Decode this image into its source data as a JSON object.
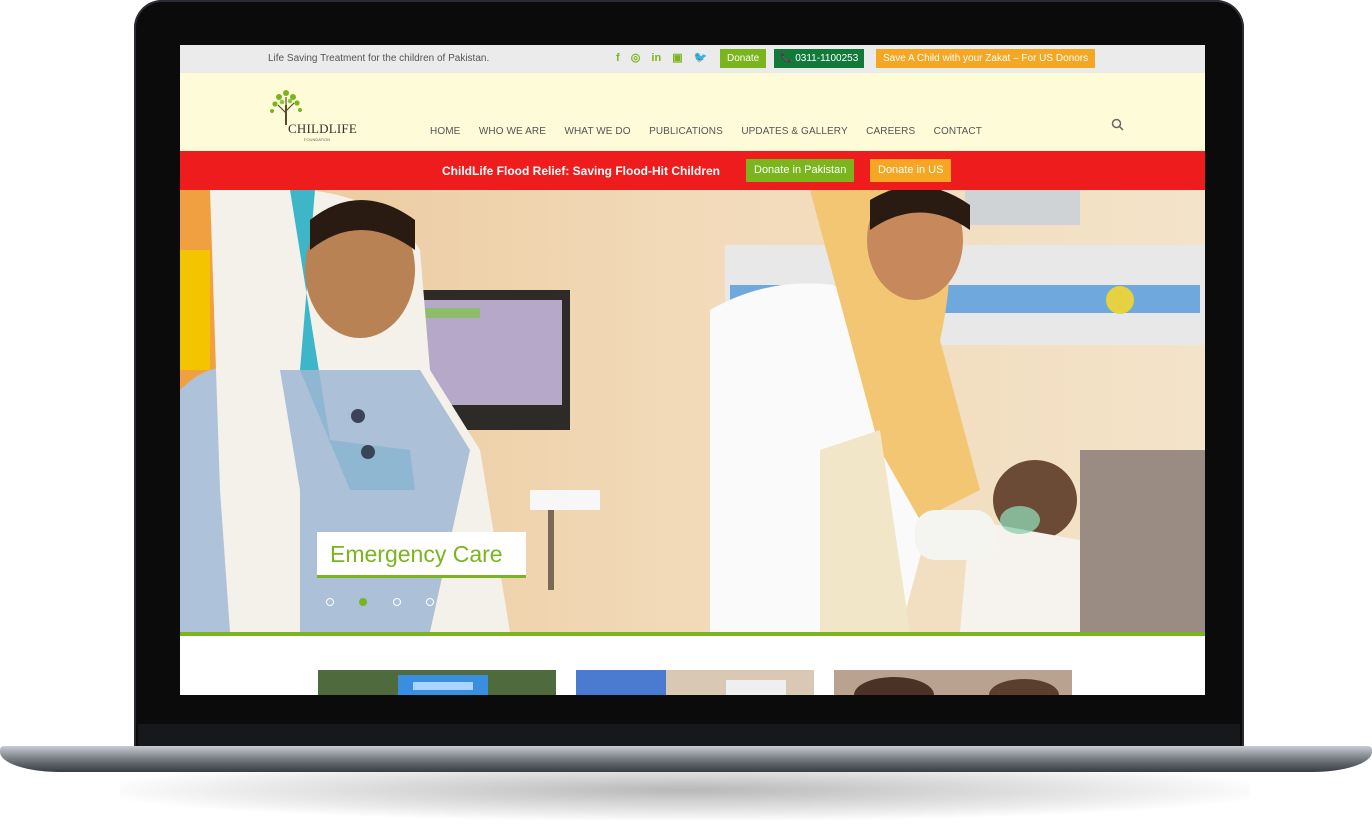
{
  "topbar": {
    "tagline": "Life Saving Treatment for the children of Pakistan.",
    "social": [
      "f",
      "◎",
      "in",
      "▣",
      "🐦"
    ],
    "donate_label": "Donate",
    "phone_label": "📞 0311-1100253",
    "zakat_label": "Save A Child with your Zakat – For US Donors"
  },
  "logo": {
    "name": "CHILDLIFE",
    "sub": "FOUNDATION"
  },
  "nav": {
    "items": [
      "HOME",
      "WHO WE ARE",
      "WHAT WE DO",
      "PUBLICATIONS",
      "UPDATES & GALLERY",
      "CAREERS",
      "CONTACT"
    ]
  },
  "banner": {
    "text": "ChildLife Flood Relief: Saving Flood-Hit Children",
    "donate_pk": "Donate in Pakistan",
    "donate_us": "Donate in US"
  },
  "hero": {
    "caption": "Emergency Care",
    "slides_total": 4,
    "active_slide": 2
  },
  "colors": {
    "brand_green": "#7ab51d",
    "dark_green": "#117a3a",
    "orange": "#f5a623",
    "banner_red": "#ee1c1c",
    "header_bg": "#fdfbd8"
  }
}
